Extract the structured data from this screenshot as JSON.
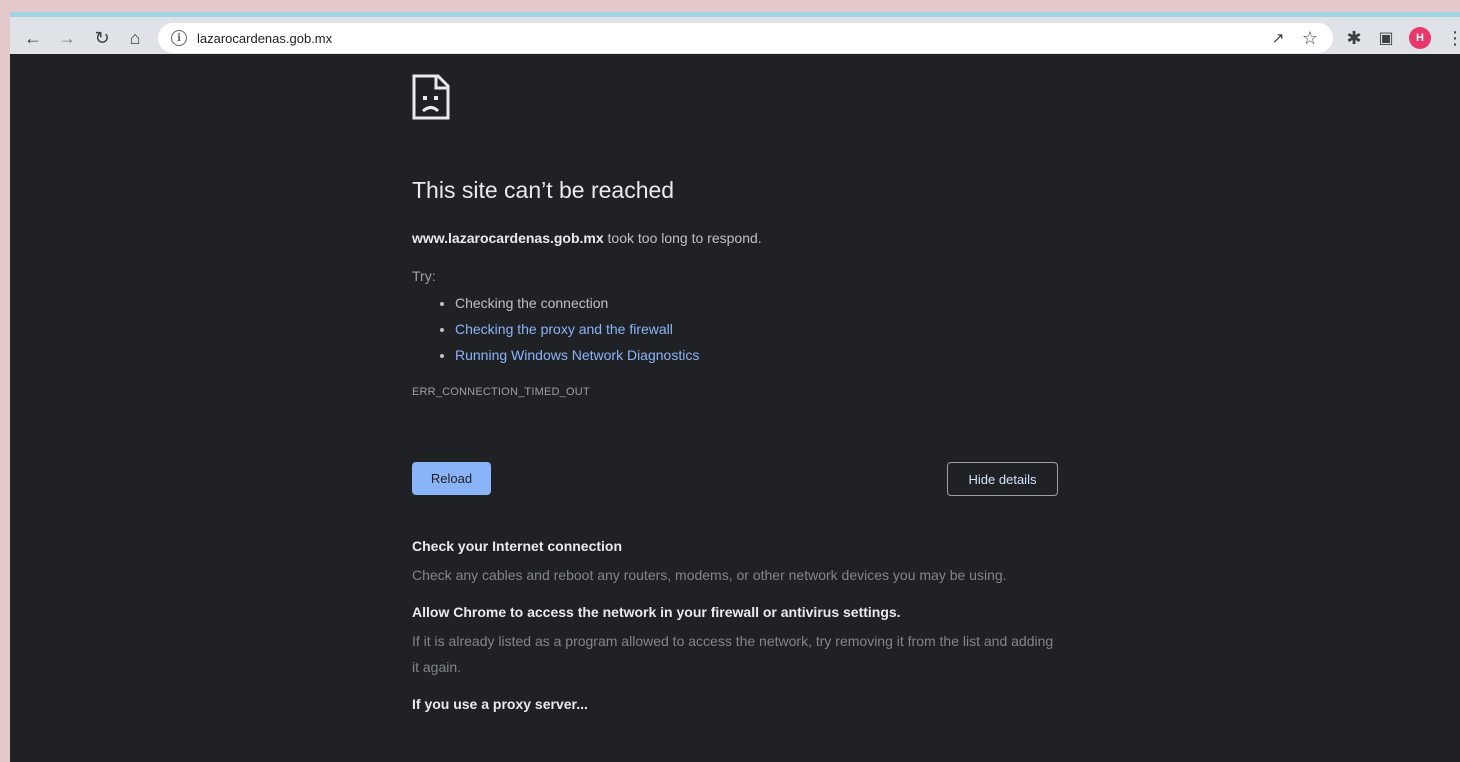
{
  "browser": {
    "url": "lazarocardenas.gob.mx",
    "avatar_initial": "H"
  },
  "error": {
    "title": "This site can’t be reached",
    "domain": "www.lazarocardenas.gob.mx",
    "message": " took too long to respond.",
    "try_label": "Try:",
    "suggestions": [
      {
        "label": "Checking the connection",
        "link": false
      },
      {
        "label": "Checking the proxy and the firewall",
        "link": true
      },
      {
        "label": "Running Windows Network Diagnostics",
        "link": true
      }
    ],
    "code": "ERR_CONNECTION_TIMED_OUT",
    "reload_label": "Reload",
    "hide_details_label": "Hide details"
  },
  "details": [
    {
      "heading": "Check your Internet connection",
      "body": "Check any cables and reboot any routers, modems, or other network devices you may be using."
    },
    {
      "heading": "Allow Chrome to access the network in your firewall or antivirus settings.",
      "body": "If it is already listed as a program allowed to access the network, try removing it from the list and adding it again."
    },
    {
      "heading": "If you use a proxy server...",
      "body": ""
    }
  ],
  "colors": {
    "background": "#202124",
    "link": "#8ab4f8",
    "avatar": "#e8376a"
  }
}
